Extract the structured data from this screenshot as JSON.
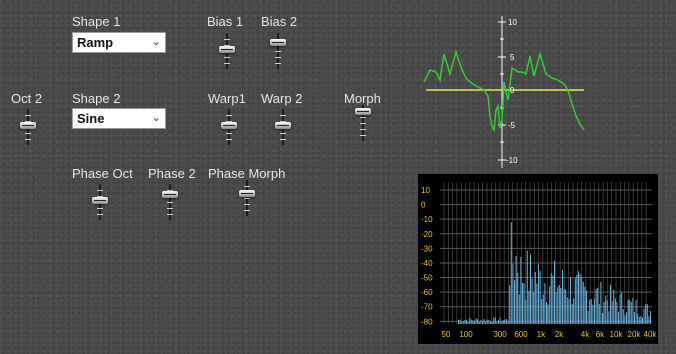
{
  "labels": {
    "shape1": "Shape 1",
    "bias1": "Bias 1",
    "bias2": "Bias 2",
    "oct2": "Oct 2",
    "shape2": "Shape 2",
    "warp1": "Warp1",
    "warp2": "Warp 2",
    "morph": "Morph",
    "phase_oct": "Phase Oct",
    "phase2": "Phase 2",
    "phase_morph": "Phase Morph"
  },
  "selects": {
    "shape1": {
      "value": "Ramp"
    },
    "shape2": {
      "value": "Sine"
    }
  },
  "scope": {
    "tick_labels": [
      "10",
      "5",
      "0",
      "-5",
      "-10"
    ],
    "colors": {
      "trace": "#33cc33",
      "zero_line": "#e8e84a",
      "axis": "#ffffff"
    }
  },
  "spectrum": {
    "y_ticks": [
      "10",
      "0",
      "-10",
      "-20",
      "-30",
      "-40",
      "-50",
      "-60",
      "-70",
      "-80"
    ],
    "x_ticks": [
      "50",
      "100",
      "300",
      "600",
      "1k",
      "2k",
      "4k",
      "6k",
      "10k",
      "20k",
      "40k"
    ],
    "colors": {
      "bars": "#6ab4e0",
      "tick_text": "#e8c42a",
      "grid": "#5a5a5a",
      "background": "#000000"
    }
  }
}
